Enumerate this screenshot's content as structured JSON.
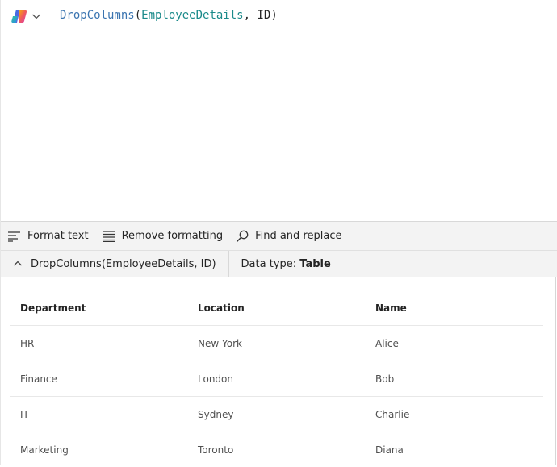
{
  "editor": {
    "formula_fn": "DropColumns",
    "formula_open": "(",
    "formula_table": "EmployeeDetails",
    "formula_sep": ", ",
    "formula_col": "ID",
    "formula_close": ")"
  },
  "toolbar": {
    "format_text": "Format text",
    "remove_formatting": "Remove formatting",
    "find_replace": "Find and replace"
  },
  "result": {
    "expression": "DropColumns(EmployeeDetails, ID)",
    "data_type_label": "Data type: ",
    "data_type_value": "Table"
  },
  "table": {
    "headers": [
      "Department",
      "Location",
      "Name"
    ],
    "rows": [
      [
        "HR",
        "New York",
        "Alice"
      ],
      [
        "Finance",
        "London",
        "Bob"
      ],
      [
        "IT",
        "Sydney",
        "Charlie"
      ],
      [
        "Marketing",
        "Toronto",
        "Diana"
      ]
    ]
  },
  "colors": {
    "function": "#3a74b0",
    "argument": "#1a8a8a"
  }
}
